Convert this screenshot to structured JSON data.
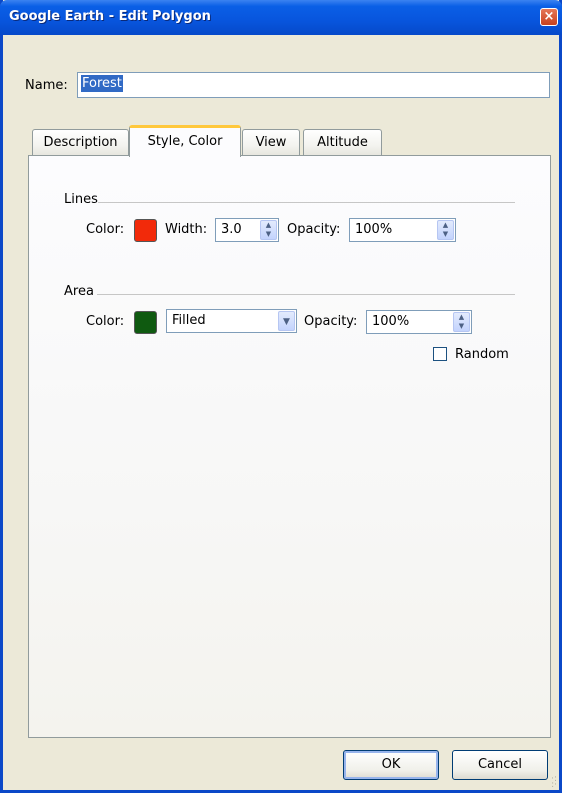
{
  "window": {
    "title": "Google Earth - Edit Polygon",
    "close_glyph": "×"
  },
  "name": {
    "label": "Name:",
    "value": "Forest"
  },
  "tabs": [
    {
      "label": "Description",
      "active": false
    },
    {
      "label": "Style, Color",
      "active": true
    },
    {
      "label": "View",
      "active": false
    },
    {
      "label": "Altitude",
      "active": false
    }
  ],
  "lines": {
    "title": "Lines",
    "color_label": "Color:",
    "color": "#f22a0a",
    "width_label": "Width:",
    "width_value": "3.0",
    "opacity_label": "Opacity:",
    "opacity_value": "100%"
  },
  "area": {
    "title": "Area",
    "color_label": "Color:",
    "color": "#0f5a10",
    "fill_mode": "Filled",
    "opacity_label": "Opacity:",
    "opacity_value": "100%",
    "random_label": "Random",
    "random_checked": false
  },
  "buttons": {
    "ok": "OK",
    "cancel": "Cancel"
  },
  "icons": {
    "close": "close-icon",
    "spin": "spin-arrows-icon",
    "dropdown": "chevron-down-icon",
    "grip": "resize-grip-icon"
  }
}
